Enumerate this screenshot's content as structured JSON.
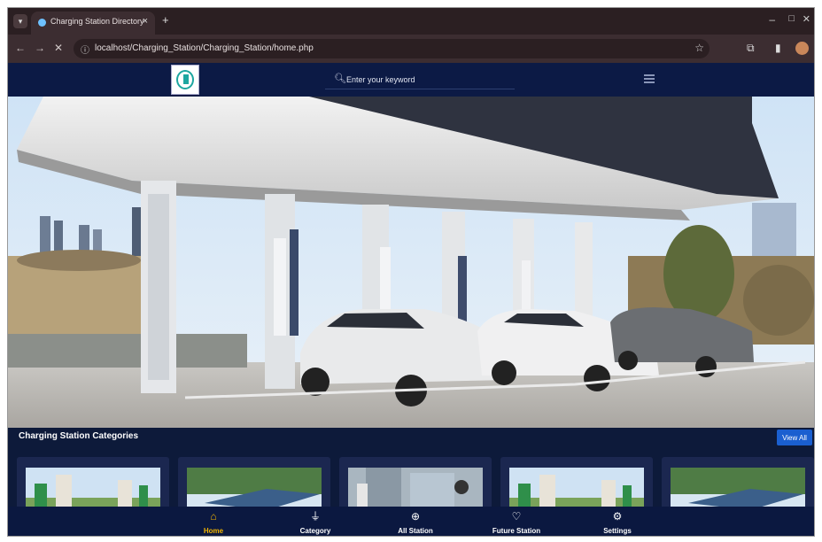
{
  "browser": {
    "tab_title": "Charging Station Directory",
    "url": "localhost/Charging_Station/Charging_Station/home.php",
    "tab_close": "×",
    "new_tab": "+"
  },
  "header": {
    "search_placeholder": "Enter your keyword",
    "logo_icon": "ev-charger-logo"
  },
  "categories": {
    "title": "Charging Station Categories",
    "view_all_label": "View All",
    "cards": [
      {
        "image": "charger-pylons"
      },
      {
        "image": "solar-canopy"
      },
      {
        "image": "city-charger"
      },
      {
        "image": "charger-pylons"
      },
      {
        "image": "solar-canopy"
      }
    ]
  },
  "bottom_nav": {
    "items": [
      {
        "label": "Home",
        "icon": "home-icon",
        "active": true
      },
      {
        "label": "Category",
        "icon": "plug-icon",
        "active": false
      },
      {
        "label": "All Station",
        "icon": "globe-icon",
        "active": false
      },
      {
        "label": "Future Station",
        "icon": "heart-icon",
        "active": false
      },
      {
        "label": "Settings",
        "icon": "gear-icon",
        "active": false
      }
    ]
  },
  "colors": {
    "header_bg": "#0c1a45",
    "accent": "#f0b400",
    "button": "#1a5fd0"
  }
}
